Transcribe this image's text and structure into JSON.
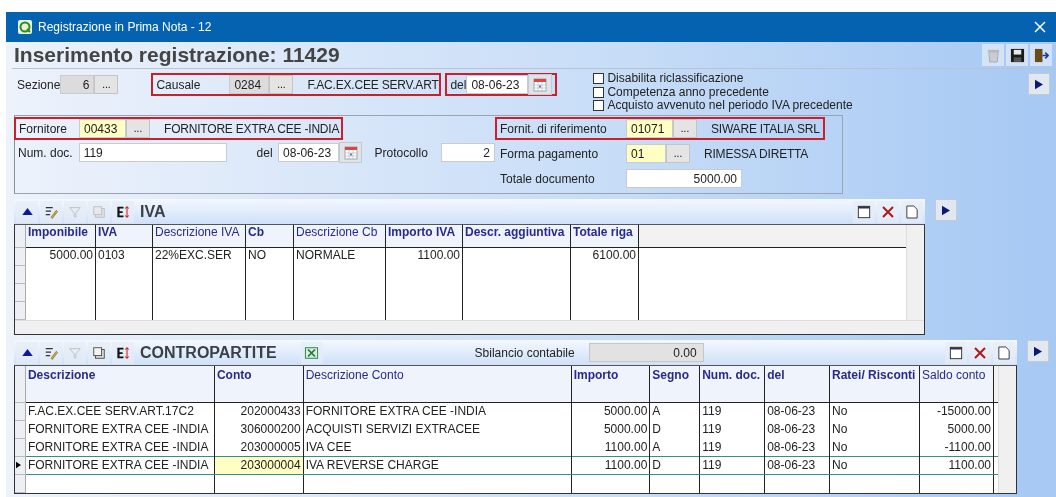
{
  "window": {
    "title": "Registrazione in Prima Nota - 12"
  },
  "heading": "Inserimento registrazione:  11429",
  "sezione": {
    "label": "Sezione",
    "code": "6",
    "button": "...",
    "disabled": true
  },
  "causale": {
    "label": "Causale",
    "code": "0284",
    "button": "...",
    "description": "F.AC.EX.CEE SERV.ART",
    "disabled": true,
    "highlighted": true
  },
  "data": {
    "label": "del",
    "value": "08-06-23",
    "highlighted": true
  },
  "options": [
    {
      "label": "Disabilita riclassificazione",
      "checked": false
    },
    {
      "label": "Competenza anno precedente",
      "checked": false
    },
    {
      "label": "Acquisto avvenuto nel periodo IVA precedente",
      "checked": false
    }
  ],
  "fornitore": {
    "label": "Fornitore",
    "code": "00433",
    "button": "...",
    "description": "FORNITORE EXTRA CEE -INDIA",
    "disabled": false,
    "highlighted": true
  },
  "num_doc": {
    "label": "Num. doc.",
    "value": "119"
  },
  "doc_date": {
    "label": "del",
    "value": "08-06-23"
  },
  "protocollo": {
    "label": "Protocollo",
    "value": "2"
  },
  "fornitore_riferimento": {
    "label": "Fornit. di riferimento",
    "code": "01071",
    "button": "...",
    "description": "SIWARE ITALIA SRL",
    "disabled": false,
    "highlighted": true
  },
  "forma_pagamento": {
    "label": "Forma pagamento",
    "code": "01",
    "button": "...",
    "description": "RIMESSA DIRETTA",
    "disabled": false
  },
  "totale_documento": {
    "label": "Totale documento",
    "value": "5000.00"
  },
  "iva": {
    "title": "IVA",
    "columns": [
      {
        "label": "Imponibile",
        "bold": true,
        "numeric": true
      },
      {
        "label": "IVA",
        "bold": true,
        "numeric": false
      },
      {
        "label": "Descrizione IVA",
        "bold": false,
        "numeric": false
      },
      {
        "label": "Cb",
        "bold": true,
        "numeric": false
      },
      {
        "label": "Descrizione Cb",
        "bold": false,
        "numeric": false
      },
      {
        "label": "Importo IVA",
        "bold": true,
        "numeric": true
      },
      {
        "label": "Descr. aggiuntiva",
        "bold": true,
        "numeric": false
      },
      {
        "label": "Totale riga",
        "bold": true,
        "numeric": true
      }
    ],
    "rows": [
      {
        "selected": false,
        "cells": [
          "5000.00",
          "0103",
          "22%EXC.SER",
          "NO",
          "NORMALE",
          "1100.00",
          "",
          "6100.00"
        ]
      }
    ]
  },
  "contropartite": {
    "title": "CONTROPARTITE",
    "balance_label": "Sbilancio contabile",
    "balance_value": "0.00",
    "columns": [
      {
        "label": "Descrizione",
        "bold": true,
        "numeric": false
      },
      {
        "label": "Conto",
        "bold": true,
        "numeric": true
      },
      {
        "label": "Descrizione Conto",
        "bold": false,
        "numeric": false
      },
      {
        "label": "Importo",
        "bold": true,
        "numeric": true
      },
      {
        "label": "Segno",
        "bold": true,
        "numeric": false
      },
      {
        "label": "Num. doc.",
        "bold": true,
        "numeric": false
      },
      {
        "label": "del",
        "bold": true,
        "numeric": false
      },
      {
        "label": "Ratei/ Risconti",
        "bold": true,
        "numeric": false
      },
      {
        "label": "Saldo conto",
        "bold": false,
        "numeric": true
      }
    ],
    "rows": [
      {
        "selected": false,
        "cells": [
          "F.AC.EX.CEE SERV.ART.17C2",
          "202000433",
          "FORNITORE EXTRA CEE -INDIA",
          "5000.00",
          "A",
          "119",
          "08-06-23",
          "No",
          "-15000.00"
        ]
      },
      {
        "selected": false,
        "cells": [
          "FORNITORE EXTRA CEE -INDIA",
          "306000200",
          "ACQUISTI SERVIZI EXTRACEE",
          "5000.00",
          "D",
          "119",
          "08-06-23",
          "No",
          "5000.00"
        ]
      },
      {
        "selected": false,
        "cells": [
          "FORNITORE EXTRA CEE -INDIA",
          "203000005",
          "IVA CEE",
          "1100.00",
          "A",
          "119",
          "08-06-23",
          "No",
          "-1100.00"
        ]
      },
      {
        "selected": true,
        "cells": [
          "FORNITORE EXTRA CEE -INDIA",
          {
            "text": "203000004",
            "focused": true
          },
          "IVA REVERSE CHARGE",
          "1100.00",
          "D",
          "119",
          "08-06-23",
          "No",
          "1100.00"
        ]
      }
    ]
  }
}
